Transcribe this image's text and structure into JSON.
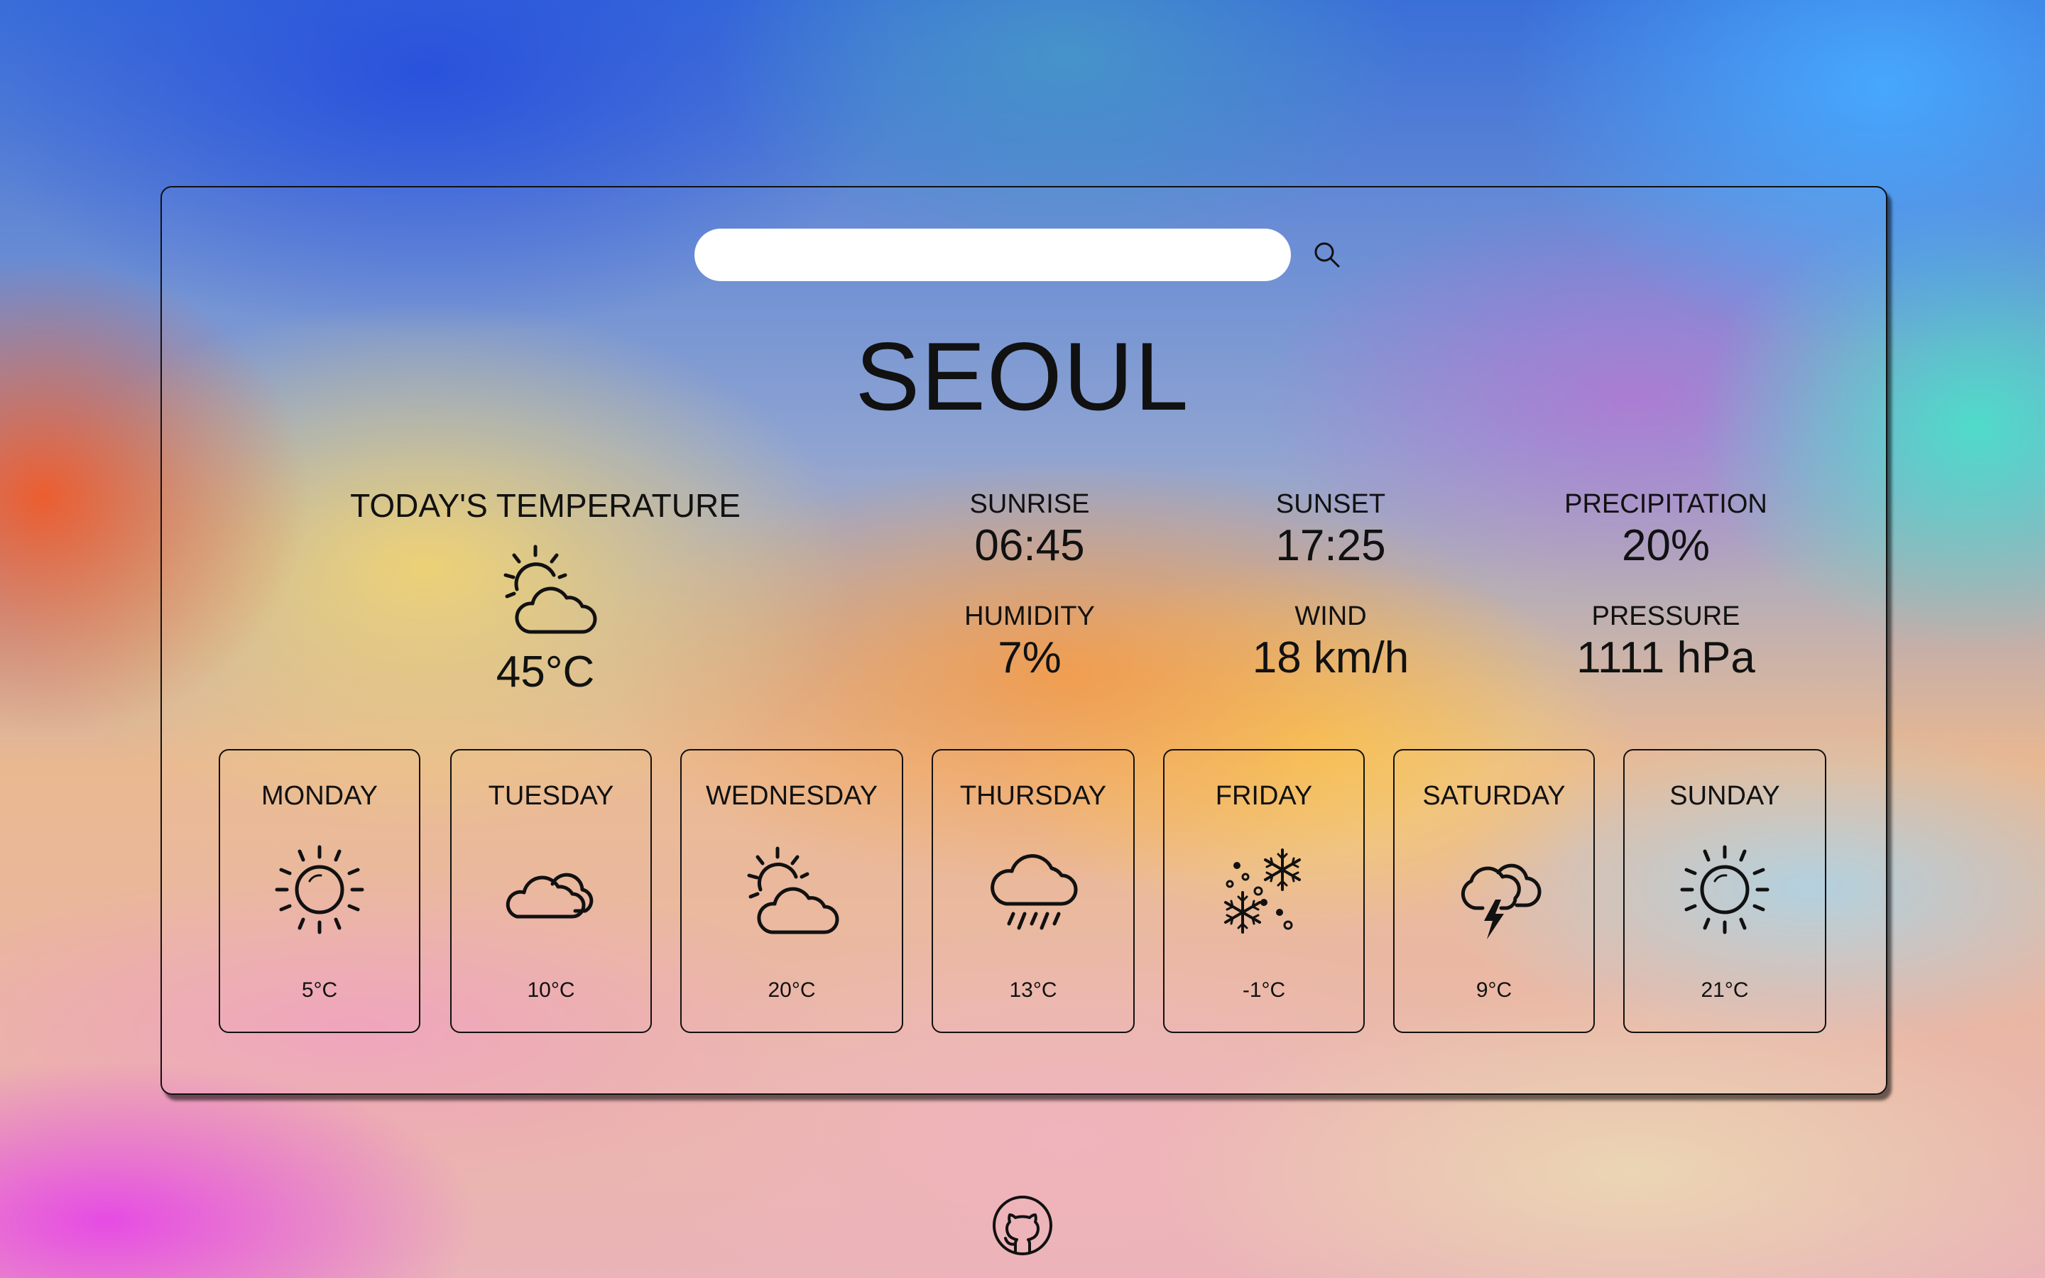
{
  "search": {
    "value": "",
    "placeholder": ""
  },
  "city": "SEOUL",
  "today": {
    "label": "TODAY'S TEMPERATURE",
    "icon": "partly-cloudy-icon",
    "temp": "45°C"
  },
  "stats": {
    "sunrise": {
      "label": "SUNRISE",
      "value": "06:45"
    },
    "sunset": {
      "label": "SUNSET",
      "value": "17:25"
    },
    "precipitation": {
      "label": "PRECIPITATION",
      "value": "20%"
    },
    "humidity": {
      "label": "HUMIDITY",
      "value": "7%"
    },
    "wind": {
      "label": "WIND",
      "value": "18 km/h"
    },
    "pressure": {
      "label": "PRESSURE",
      "value": "1111 hPa"
    }
  },
  "forecast": [
    {
      "day": "MONDAY",
      "icon": "sun-icon",
      "temp": "5°C"
    },
    {
      "day": "TUESDAY",
      "icon": "cloudy-icon",
      "temp": "10°C"
    },
    {
      "day": "WEDNESDAY",
      "icon": "partly-cloudy-icon",
      "temp": "20°C"
    },
    {
      "day": "THURSDAY",
      "icon": "rain-icon",
      "temp": "13°C"
    },
    {
      "day": "FRIDAY",
      "icon": "snow-icon",
      "temp": "-1°C"
    },
    {
      "day": "SATURDAY",
      "icon": "thunderstorm-icon",
      "temp": "9°C"
    },
    {
      "day": "SUNDAY",
      "icon": "sun-icon",
      "temp": "21°C"
    }
  ],
  "footer": {
    "icon": "github-icon"
  }
}
